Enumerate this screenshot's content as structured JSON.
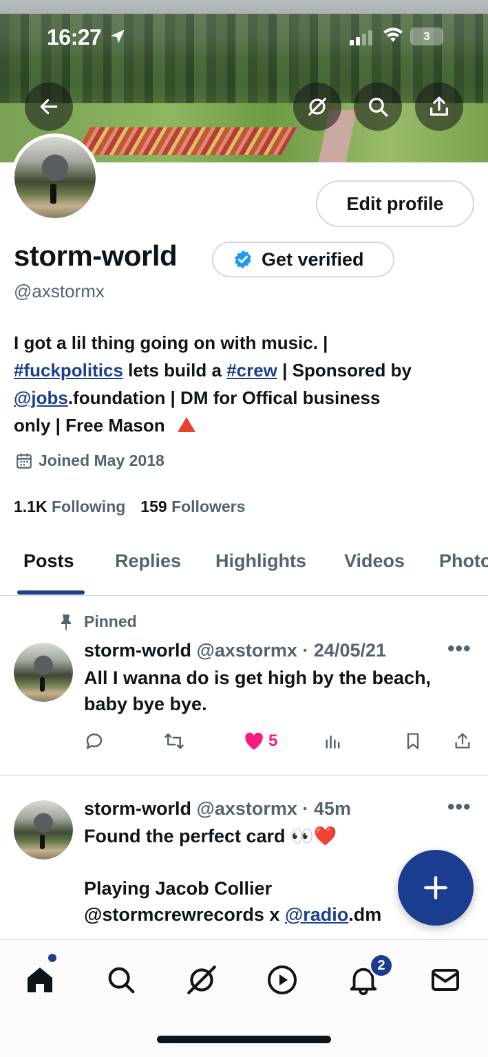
{
  "status_bar": {
    "time": "16:27",
    "battery": "3"
  },
  "profile": {
    "name": "storm-world",
    "handle": "@axstormx",
    "edit_label": "Edit profile",
    "verify_label": "Get verified",
    "bio": {
      "line1": "I got a lil thing going on with music. |",
      "tag1": "#fuckpolitics",
      "mid1": " lets build a ",
      "tag2": "#crew",
      "mid2": " | Sponsored by",
      "mention": "@jobs",
      "line3_rest": ".foundation | DM for Offical business",
      "line4": "only | Free Mason"
    },
    "joined": "Joined May 2018",
    "following_count": "1.1K",
    "following_label": "Following",
    "followers_count": "159",
    "followers_label": "Followers"
  },
  "tabs": [
    "Posts",
    "Replies",
    "Highlights",
    "Videos",
    "Photos"
  ],
  "posts": [
    {
      "pinned_label": "Pinned",
      "name": "storm-world",
      "handle_time": "@axstormx · 24/05/21",
      "text1": "All I wanna do is get high by the beach,",
      "text2": "baby bye bye.",
      "likes": "5"
    },
    {
      "name": "storm-world",
      "handle_time": "@axstormx · 45m",
      "text1": "Found the perfect card 👀❤️",
      "text2": "Playing Jacob Collier",
      "text3_a": "@stormcrewrecords x ",
      "text3_link": "@radio",
      "text3_b": ".dm"
    }
  ],
  "notifications_badge": "2",
  "colors": {
    "accent": "#1a3d8f",
    "like": "#f91880",
    "muted": "#536471"
  }
}
